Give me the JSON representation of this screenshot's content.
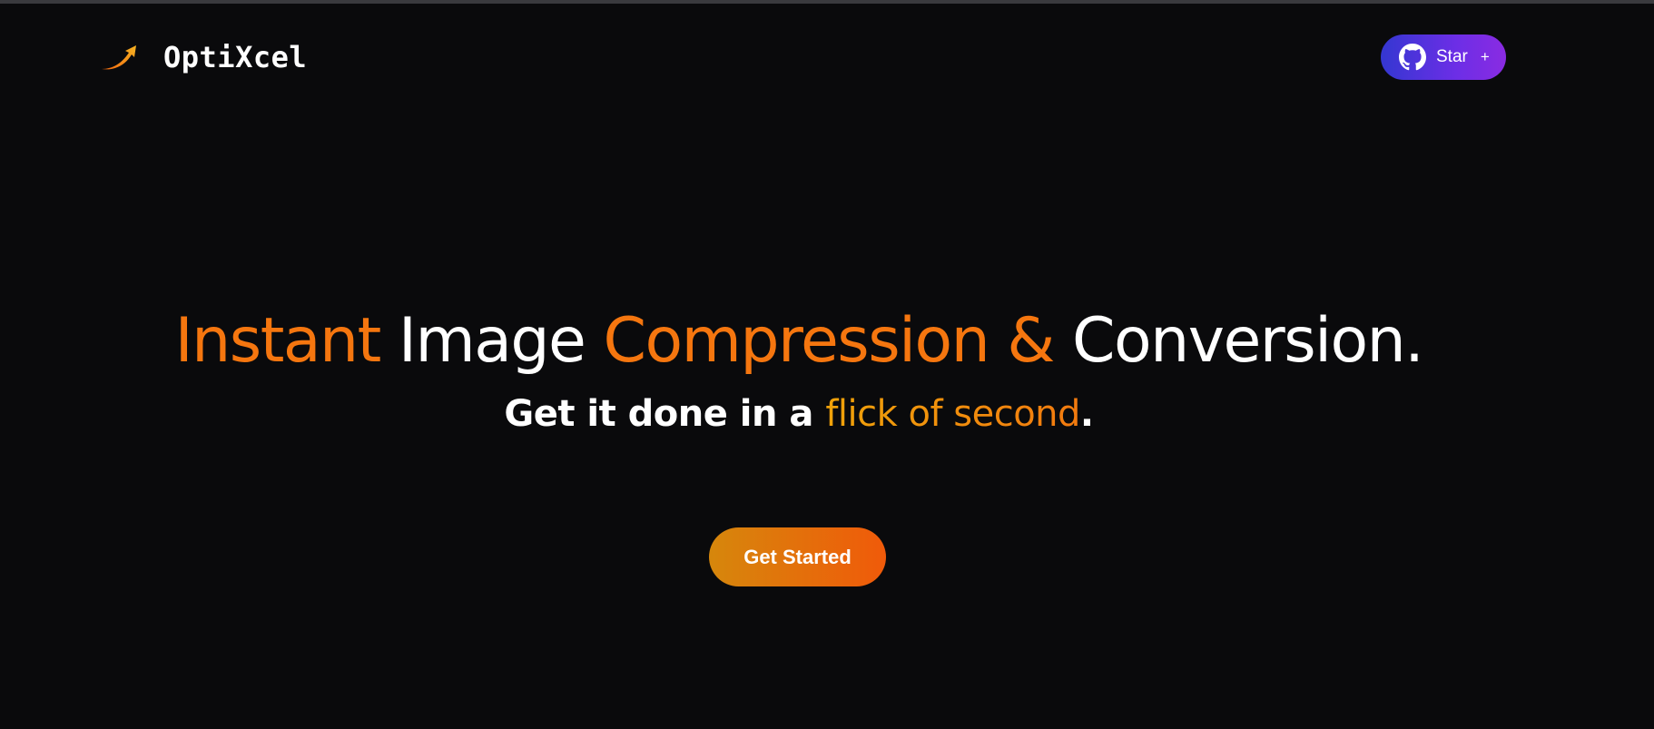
{
  "brand": {
    "name": "OptiXcel",
    "icon": "arrow-up-right-icon"
  },
  "github_button": {
    "icon": "github-icon",
    "label": "Star",
    "plus": "+"
  },
  "hero": {
    "headline": {
      "word1": "Instant",
      "word2": "Image",
      "word3": "Compression &",
      "word4": "Conversion."
    },
    "subheadline": {
      "prefix": "Get it done in a",
      "highlight": "flick of second",
      "suffix": "."
    },
    "cta_label": "Get Started"
  },
  "colors": {
    "background": "#0a0a0c",
    "accent_orange": "#f5760f",
    "github_gradient_start": "#3437d1",
    "github_gradient_end": "#8a2be2",
    "cta_gradient_start": "#d6870c",
    "cta_gradient_end": "#f05a0a"
  }
}
